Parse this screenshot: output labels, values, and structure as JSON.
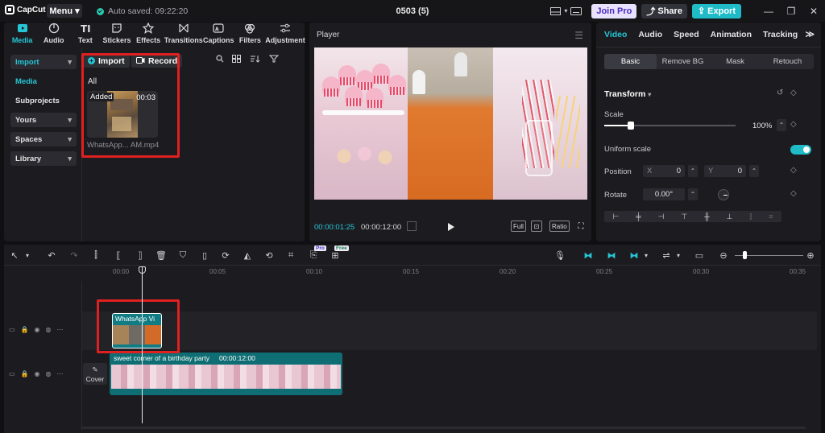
{
  "app": {
    "logo_text": "CapCut",
    "menu_label": "Menu",
    "autosave_text": "Auto saved: 09:22:20",
    "project_title": "0503 (5)",
    "join_pro_label": "Join Pro",
    "share_label": "Share",
    "export_label": "Export"
  },
  "left_tabs": [
    {
      "label": "Media",
      "icon": "media-icon",
      "active": true
    },
    {
      "label": "Audio",
      "icon": "audio-icon"
    },
    {
      "label": "Text",
      "icon": "text-icon"
    },
    {
      "label": "Stickers",
      "icon": "stickers-icon"
    },
    {
      "label": "Effects",
      "icon": "effects-icon"
    },
    {
      "label": "Transitions",
      "icon": "transitions-icon"
    },
    {
      "label": "Captions",
      "icon": "captions-icon"
    },
    {
      "label": "Filters",
      "icon": "filters-icon"
    },
    {
      "label": "Adjustment",
      "icon": "adjustment-icon"
    }
  ],
  "sidebar": {
    "import": "Import",
    "media": "Media",
    "subprojects": "Subprojects",
    "yours": "Yours",
    "spaces": "Spaces",
    "library": "Library"
  },
  "media_panel": {
    "import_label": "Import",
    "record_label": "Record",
    "filter_label": "All",
    "item": {
      "badge": "Added",
      "duration": "00:03",
      "filename": "WhatsApp... AM.mp4"
    }
  },
  "player": {
    "title": "Player",
    "current_time": "00:00:01:25",
    "total_time": "00:00:12:00",
    "full_label": "Full",
    "ratio_label": "Ratio"
  },
  "right_panel": {
    "tabs": [
      "Video",
      "Audio",
      "Speed",
      "Animation",
      "Tracking"
    ],
    "subtabs": [
      "Basic",
      "Remove BG",
      "Mask",
      "Retouch"
    ],
    "transform_label": "Transform",
    "scale_label": "Scale",
    "scale_value": "100%",
    "scale_fraction": 0.2,
    "uniform_scale_label": "Uniform scale",
    "position_label": "Position",
    "pos_x_key": "X",
    "pos_x_value": "0",
    "pos_y_key": "Y",
    "pos_y_value": "0",
    "rotate_label": "Rotate",
    "rotate_value": "0.00°"
  },
  "timeline": {
    "pro_badge": "Pro",
    "free_badge": "Free",
    "ruler_labels": [
      "00:00",
      "00:05",
      "00:10",
      "00:15",
      "00:20",
      "00:25",
      "00:30",
      "00:35"
    ],
    "clip_overlay_label": "WhatsApp Vi",
    "clip_main_label": "sweet corner of a birthday party",
    "clip_main_duration": "00:00:12:00",
    "cover_label": "Cover"
  },
  "colors": {
    "accent": "#26c6d6",
    "highlight": "#e02020"
  }
}
